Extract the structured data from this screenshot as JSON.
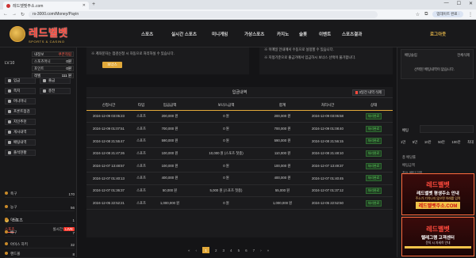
{
  "browser": {
    "tab_title": "레드벳벳주소.com",
    "url": "rs-3000.com/Money/Payin",
    "login_pill": "업데이트 완료 :"
  },
  "header": {
    "logo_main": "레드벨벳",
    "logo_sub": "SPORTS & CASINO",
    "nav": [
      "스포츠",
      "실시간 스포츠",
      "미니게임",
      "가상스포츠",
      "카지노",
      "슬롯",
      "이벤트",
      "스포츠결과"
    ],
    "logout": "로그아웃"
  },
  "sidebar": {
    "level": "LV.10",
    "account_rows": [
      {
        "label": "내정보",
        "value": "쿠폰적립"
      },
      {
        "label": "스포츠머니",
        "value": "0원"
      },
      {
        "label": "포인트",
        "value": "0원"
      },
      {
        "label": "레벨",
        "value": "111 원"
      }
    ],
    "menu": [
      "입금",
      "출금",
      "쪽지",
      "충전",
      "머니머니",
      "프론트점검",
      "지인추천",
      "게시내역",
      "배팅내역",
      "출석현황"
    ],
    "sports_title": "스포츠",
    "sports_tabs": [
      "스포츠",
      "실시간",
      "LIVE"
    ],
    "sports": [
      {
        "name": "축구",
        "count": "170"
      },
      {
        "name": "농구",
        "count": "56"
      },
      {
        "name": "야구",
        "count": "1"
      },
      {
        "name": "배구",
        "count": "7"
      },
      {
        "name": "아이스 하키",
        "count": "32"
      },
      {
        "name": "핸드볼",
        "count": "8"
      }
    ]
  },
  "main": {
    "note_left": "※ 계좌문자는 점검신청 시 자동으로 처리하실 수 있습니다.",
    "bonus_button": "보너스",
    "note_right_1": "※ 이메일 안내에서 수동으로 설정할 수 있습니다.",
    "note_right_2": "※ 지정기준으로 출금가에서 입금하시 보너스 선택이 불가합니다.",
    "history_title": "입금내역",
    "delete_button": "3일전 내역 삭제",
    "columns": [
      "신청시간",
      "타입",
      "입금금액",
      "보너스금액",
      "합계",
      "처리시간",
      "상태"
    ],
    "rows": [
      {
        "req": "2024-12-09 03:05:23",
        "type": "스포츠",
        "amount": "200,000 원",
        "bonus": "0 원",
        "total": "200,000 원",
        "done": "2024-12-09 03:06:58",
        "status": "처리완료"
      },
      {
        "req": "2024-12-09 01:07:51",
        "type": "스포츠",
        "amount": "700,000 원",
        "bonus": "0 원",
        "total": "700,000 원",
        "done": "2024-12-09 01:08:40",
        "status": "처리완료"
      },
      {
        "req": "2024-12-08 21:55:47",
        "type": "스포츠",
        "amount": "590,000 원",
        "bonus": "0 원",
        "total": "590,000 원",
        "done": "2024-12-08 21:56:15",
        "status": "처리완료"
      },
      {
        "req": "2024-12-08 21:47:26",
        "type": "스포츠",
        "amount": "100,000 원",
        "bonus": "10,000 원 (스포츠 첫충)",
        "total": "110,000 원",
        "done": "2024-12-08 21:48:10",
        "status": "처리완료"
      },
      {
        "req": "2024-12-07 13:48:57",
        "type": "스포츠",
        "amount": "100,000 원",
        "bonus": "0 원",
        "total": "100,000 원",
        "done": "2024-12-07 13:49:37",
        "status": "처리완료"
      },
      {
        "req": "2024-12-07 01:40:13",
        "type": "스포츠",
        "amount": "400,000 원",
        "bonus": "0 원",
        "total": "400,000 원",
        "done": "2024-12-07 01:40:45",
        "status": "처리완료"
      },
      {
        "req": "2024-12-07 01:36:37",
        "type": "스포츠",
        "amount": "50,000 원",
        "bonus": "5,000 원 (스포츠 첫충)",
        "total": "55,000 원",
        "done": "2024-12-07 01:37:12",
        "status": "처리완료"
      },
      {
        "req": "2024-12-05 22:52:21",
        "type": "스포츠",
        "amount": "1,000,000 원",
        "bonus": "0 원",
        "total": "1,000,000 원",
        "done": "2024-12-05 22:52:50",
        "status": "처리완료"
      }
    ],
    "pager": [
      "«",
      "‹",
      "1",
      "2",
      "3",
      "4",
      "5",
      "6",
      "7",
      "›",
      "»"
    ]
  },
  "right": {
    "betslip_label": "배팅슬립",
    "betslip_toggle": "전체삭제",
    "betslip_empty": "선택된 배팅내역이 없습니다.",
    "bet_label": "배팅",
    "bet_tabs": [
      "1만",
      "5만",
      "10만",
      "50만",
      "100만",
      "최대"
    ],
    "bet_rows": [
      "총 배당률",
      "배팅금액",
      "최소 배팅금액",
      "최대 배팅금액",
      "최대 적중금액"
    ],
    "bet_button": "배팅하기",
    "banner1": {
      "title": "레드벨벳",
      "line1": "레드벨벳 평생주소 안내",
      "line2": "주소가 기억나지 않으면 아래를 입력",
      "url": "레드벨벳주소.COM",
      "line3": ""
    },
    "banner2": {
      "title": "레드벨벳",
      "line1": "텔레그램 고객센터",
      "line2": "",
      "url": "",
      "line3": "문의 시 자세히 안내"
    }
  },
  "colors": {
    "accent": "#e1a93a",
    "brand_red": "#ff4a3d",
    "status_green": "#5fd35f",
    "bg": "#141416"
  }
}
